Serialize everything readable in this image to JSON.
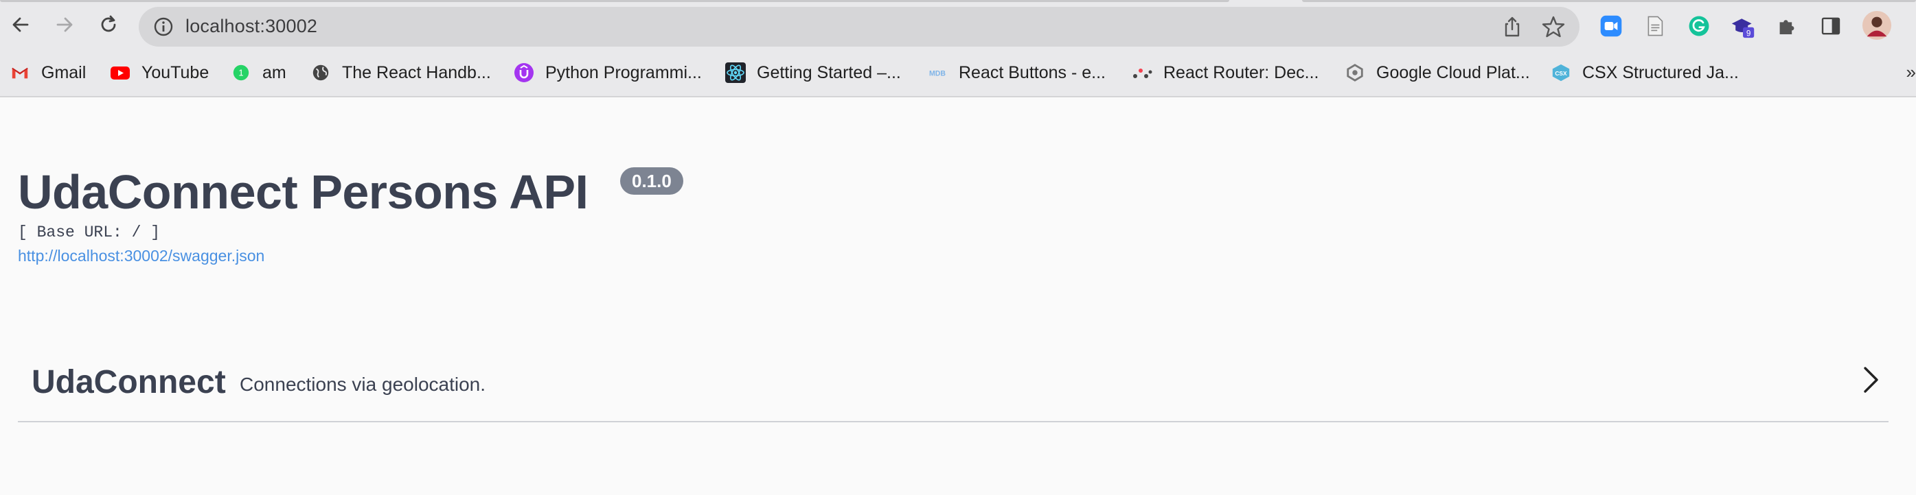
{
  "browser": {
    "url": "localhost:30002",
    "extension_badge": "9"
  },
  "bookmarks": [
    {
      "label": "Gmail",
      "icon": "gmail-icon"
    },
    {
      "label": "YouTube",
      "icon": "youtube-icon"
    },
    {
      "label": "am",
      "icon": "whatsapp-icon"
    },
    {
      "label": "The React Handb...",
      "icon": "globe-icon"
    },
    {
      "label": "Python Programmi...",
      "icon": "udemy-icon"
    },
    {
      "label": "Getting Started –...",
      "icon": "react-icon"
    },
    {
      "label": "React Buttons - e...",
      "icon": "mdb-icon"
    },
    {
      "label": "React Router: Dec...",
      "icon": "react-router-icon"
    },
    {
      "label": "Google Cloud Plat...",
      "icon": "google-cloud-icon"
    },
    {
      "label": "CSX Structured Ja...",
      "icon": "csx-icon"
    }
  ],
  "api": {
    "title": "UdaConnect Persons API",
    "version": "0.1.0",
    "base_url": "[ Base URL: / ]",
    "spec_link": "http://localhost:30002/swagger.json"
  },
  "tags": [
    {
      "name": "UdaConnect",
      "description": "Connections via geolocation."
    }
  ]
}
